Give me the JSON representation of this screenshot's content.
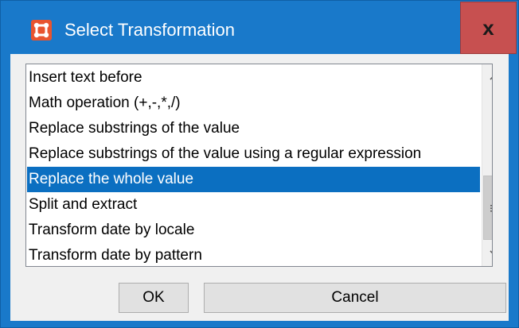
{
  "window": {
    "title": "Select Transformation",
    "close_label": "x",
    "app_icon": "app-logo-icon"
  },
  "list": {
    "items": [
      {
        "label": "Insert text before",
        "selected": false
      },
      {
        "label": "Math operation (+,-,*,/)",
        "selected": false
      },
      {
        "label": "Replace substrings of the value",
        "selected": false
      },
      {
        "label": "Replace substrings of the value using a regular expression",
        "selected": false
      },
      {
        "label": "Replace the whole value",
        "selected": true
      },
      {
        "label": "Split and extract",
        "selected": false
      },
      {
        "label": "Transform date by locale",
        "selected": false
      },
      {
        "label": "Transform date by pattern",
        "selected": false
      }
    ],
    "scroll_up_icon": "chevron-up-icon",
    "scroll_down_icon": "chevron-down-icon",
    "thumb_grip_icon": "grip-lines-icon"
  },
  "buttons": {
    "ok_label": "OK",
    "cancel_label": "Cancel"
  },
  "colors": {
    "titlebar": "#1979ca",
    "close_button": "#c75050",
    "selection": "#0b6fc1",
    "app_icon": "#e8542f"
  }
}
